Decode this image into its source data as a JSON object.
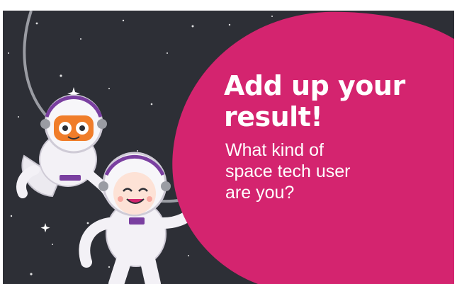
{
  "card": {
    "headline": "Add up your result!",
    "subline": "What kind of space tech user are you?"
  },
  "colors": {
    "background": "#2d2f36",
    "accent": "#d4246f",
    "text": "#ffffff",
    "robot_visor": "#f07d2a",
    "suit_trim": "#7a3fa0"
  },
  "illustration": {
    "figures": [
      "robot-astronaut",
      "smiling-astronaut"
    ],
    "decor": [
      "stars",
      "tether-rope"
    ]
  }
}
